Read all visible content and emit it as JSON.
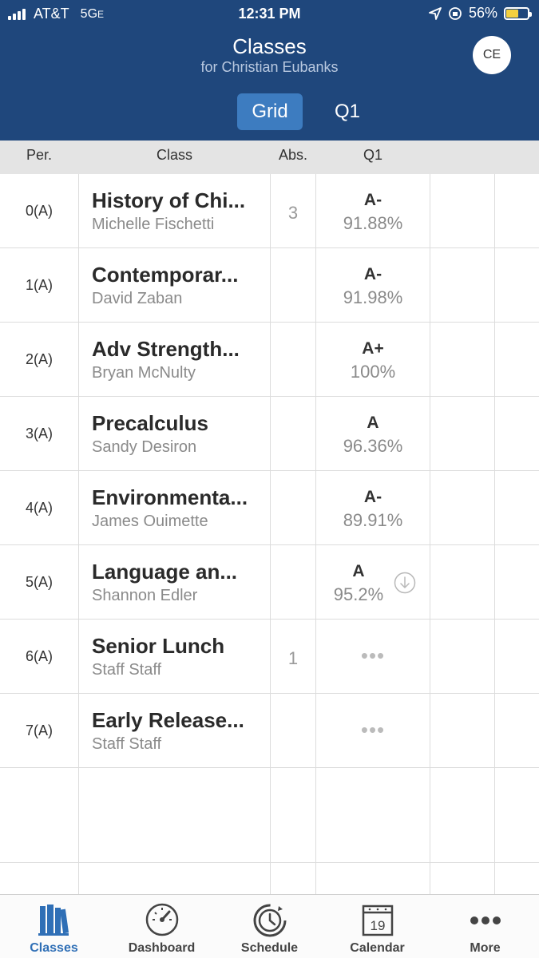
{
  "status_bar": {
    "carrier": "AT&T",
    "network": "5G",
    "network_suffix": "E",
    "time": "12:31 PM",
    "battery": "56%",
    "battery_level": 0.56
  },
  "header": {
    "title": "Classes",
    "subtitle": "for Christian Eubanks",
    "avatar": "CE"
  },
  "segments": [
    {
      "label": "Grid",
      "active": true
    },
    {
      "label": "Q1",
      "active": false
    }
  ],
  "columns": {
    "per": "Per.",
    "class": "Class",
    "abs": "Abs.",
    "q1": "Q1"
  },
  "rows": [
    {
      "per": "0(A)",
      "class": "History of Chi...",
      "teacher": "Michelle Fischetti",
      "abs": "3",
      "grade": "A-",
      "pct": "91.88%"
    },
    {
      "per": "1(A)",
      "class": "Contemporar...",
      "teacher": "David Zaban",
      "abs": "",
      "grade": "A-",
      "pct": "91.98%"
    },
    {
      "per": "2(A)",
      "class": "Adv Strength...",
      "teacher": "Bryan McNulty",
      "abs": "",
      "grade": "A+",
      "pct": "100%"
    },
    {
      "per": "3(A)",
      "class": "Precalculus",
      "teacher": "Sandy Desiron",
      "abs": "",
      "grade": "A",
      "pct": "96.36%"
    },
    {
      "per": "4(A)",
      "class": "Environmenta...",
      "teacher": "James Ouimette",
      "abs": "",
      "grade": "A-",
      "pct": "89.91%"
    },
    {
      "per": "5(A)",
      "class": "Language an...",
      "teacher": "Shannon Edler",
      "abs": "",
      "grade": "A",
      "pct": "95.2%",
      "trend_icon": "arrow-down-circle-icon"
    },
    {
      "per": "6(A)",
      "class": "Senior Lunch",
      "teacher": "Staff Staff",
      "abs": "1",
      "grade": "",
      "pct": "",
      "placeholder": "•••"
    },
    {
      "per": "7(A)",
      "class": "Early Release...",
      "teacher": "Staff Staff",
      "abs": "",
      "grade": "",
      "pct": "",
      "placeholder": "•••"
    }
  ],
  "tabs": [
    {
      "label": "Classes",
      "icon": "books-icon",
      "active": true
    },
    {
      "label": "Dashboard",
      "icon": "gauge-icon",
      "active": false
    },
    {
      "label": "Schedule",
      "icon": "clock-icon",
      "active": false
    },
    {
      "label": "Calendar",
      "icon": "calendar-icon",
      "active": false,
      "day": "19"
    },
    {
      "label": "More",
      "icon": "more-icon",
      "active": false
    }
  ],
  "colors": {
    "header_bg": "#1f477c",
    "segment_active": "#3d7cc0",
    "accent": "#2f6fb6"
  }
}
